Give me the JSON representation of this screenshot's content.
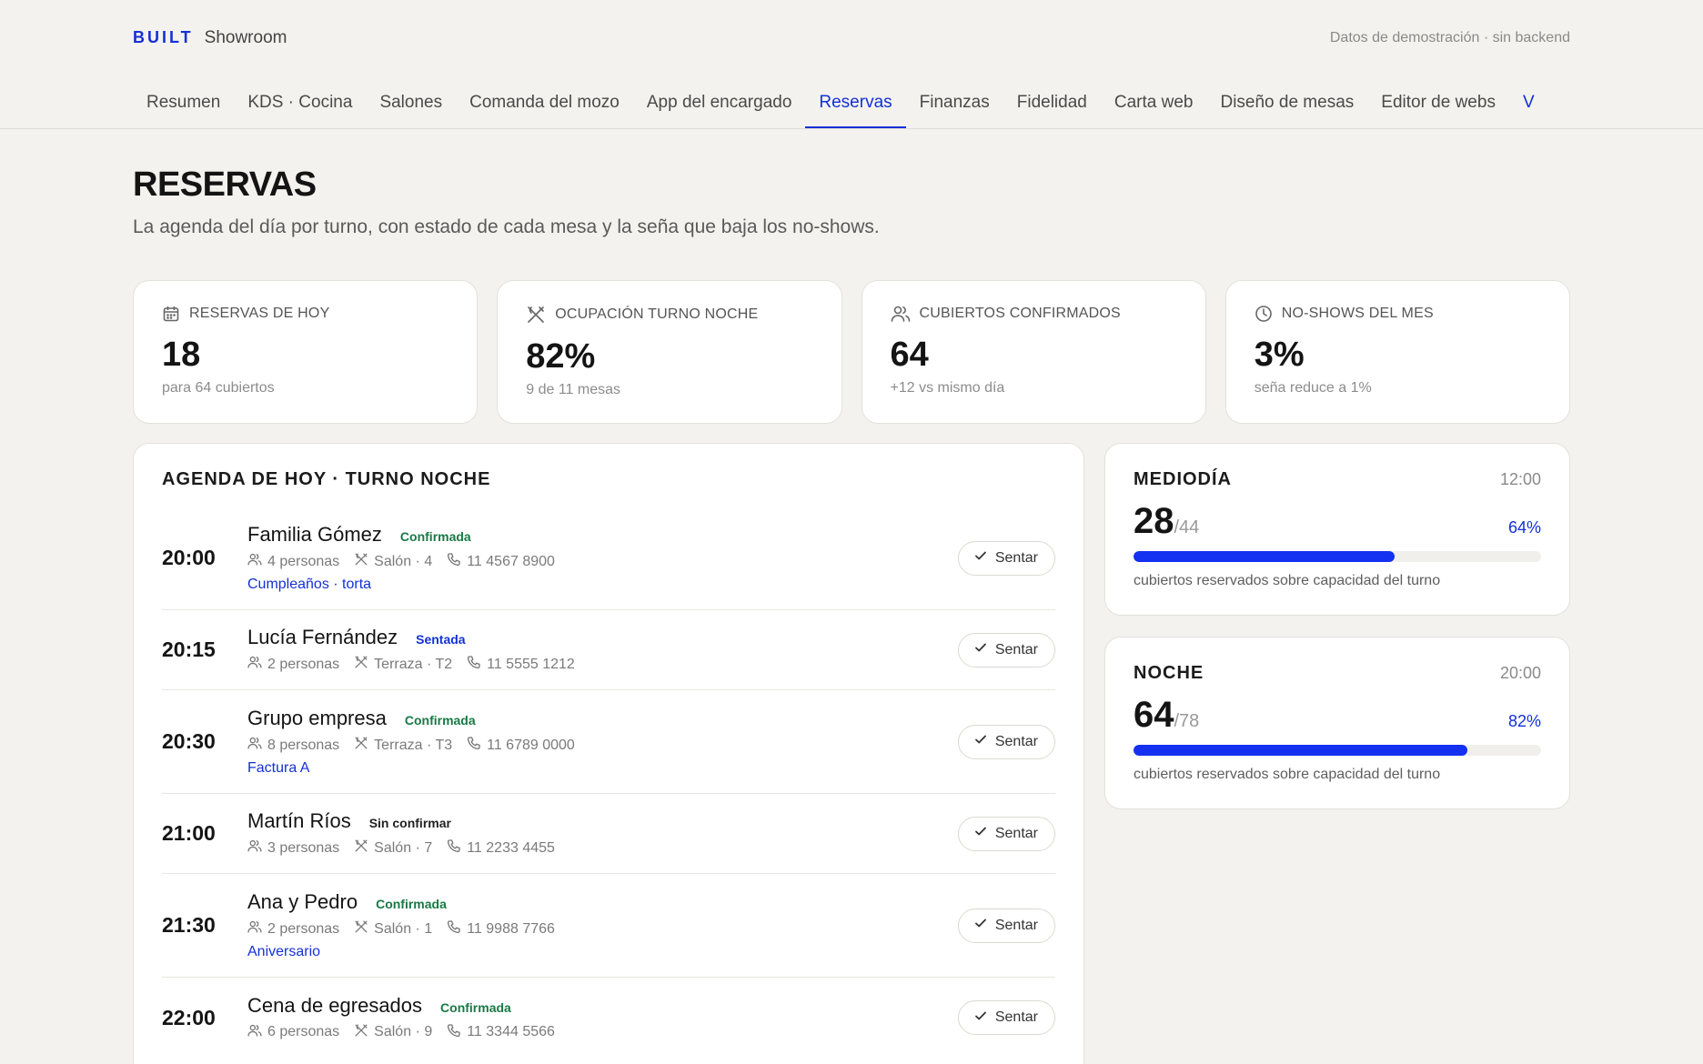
{
  "brand": {
    "mark": "BUILT",
    "name": "Showroom"
  },
  "demo_note": "Datos de demostración · sin backend",
  "tabs": [
    {
      "label": "Resumen",
      "active": false
    },
    {
      "label": "KDS · Cocina",
      "active": false
    },
    {
      "label": "Salones",
      "active": false
    },
    {
      "label": "Comanda del mozo",
      "active": false
    },
    {
      "label": "App del encargado",
      "active": false
    },
    {
      "label": "Reservas",
      "active": true
    },
    {
      "label": "Finanzas",
      "active": false
    },
    {
      "label": "Fidelidad",
      "active": false
    },
    {
      "label": "Carta web",
      "active": false
    },
    {
      "label": "Diseño de mesas",
      "active": false
    },
    {
      "label": "Editor de webs",
      "active": false
    },
    {
      "label": "V",
      "active": false
    }
  ],
  "page": {
    "title": "RESERVAS",
    "subtitle": "La agenda del día por turno, con estado de cada mesa y la seña que baja los no-shows."
  },
  "kpis": [
    {
      "icon": "calendar-icon",
      "label": "RESERVAS DE HOY",
      "value": "18",
      "note": "para 64 cubiertos"
    },
    {
      "icon": "utensils-icon",
      "label": "OCUPACIÓN TURNO NOCHE",
      "value": "82%",
      "note": "9 de 11 mesas"
    },
    {
      "icon": "users-icon",
      "label": "CUBIERTOS CONFIRMADOS",
      "value": "64",
      "note": "+12 vs mismo día"
    },
    {
      "icon": "clock-icon",
      "label": "NO-SHOWS DEL MES",
      "value": "3%",
      "note": "seña reduce a 1%"
    }
  ],
  "agenda": {
    "title": "AGENDA DE HOY · TURNO NOCHE",
    "action_label": "Sentar",
    "rows": [
      {
        "time": "20:00",
        "name": "Familia Gómez",
        "status": "Confirmada",
        "status_color": "#177a45",
        "people": "4 personas",
        "table": "Salón · 4",
        "phone": "11 4567 8900",
        "note": "Cumpleaños · torta"
      },
      {
        "time": "20:15",
        "name": "Lucía Fernández",
        "status": "Sentada",
        "status_color": "#1430d6",
        "people": "2 personas",
        "table": "Terraza · T2",
        "phone": "11 5555 1212",
        "note": ""
      },
      {
        "time": "20:30",
        "name": "Grupo empresa",
        "status": "Confirmada",
        "status_color": "#177a45",
        "people": "8 personas",
        "table": "Terraza · T3",
        "phone": "11 6789 0000",
        "note": "Factura A"
      },
      {
        "time": "21:00",
        "name": "Martín Ríos",
        "status": "Sin confirmar",
        "status_color": "#222222",
        "people": "3 personas",
        "table": "Salón · 7",
        "phone": "11 2233 4455",
        "note": ""
      },
      {
        "time": "21:30",
        "name": "Ana y Pedro",
        "status": "Confirmada",
        "status_color": "#177a45",
        "people": "2 personas",
        "table": "Salón · 1",
        "phone": "11 9988 7766",
        "note": "Aniversario"
      },
      {
        "time": "22:00",
        "name": "Cena de egresados",
        "status": "Confirmada",
        "status_color": "#177a45",
        "people": "6 personas",
        "table": "Salón · 9",
        "phone": "11 3344 5566",
        "note": ""
      }
    ]
  },
  "shifts": [
    {
      "name": "MEDIODÍA",
      "time": "12:00",
      "reserved": "28",
      "capacity": "/44",
      "percent": "64%",
      "fill": 0.64,
      "note": "cubiertos reservados sobre capacidad del turno"
    },
    {
      "name": "NOCHE",
      "time": "20:00",
      "reserved": "64",
      "capacity": "/78",
      "percent": "82%",
      "fill": 0.82,
      "note": "cubiertos reservados sobre capacidad del turno"
    }
  ],
  "colors": {
    "accent": "#1430d6",
    "bar": "#1430f0",
    "confirmed": "#177a45",
    "background": "#f3f2ee"
  }
}
